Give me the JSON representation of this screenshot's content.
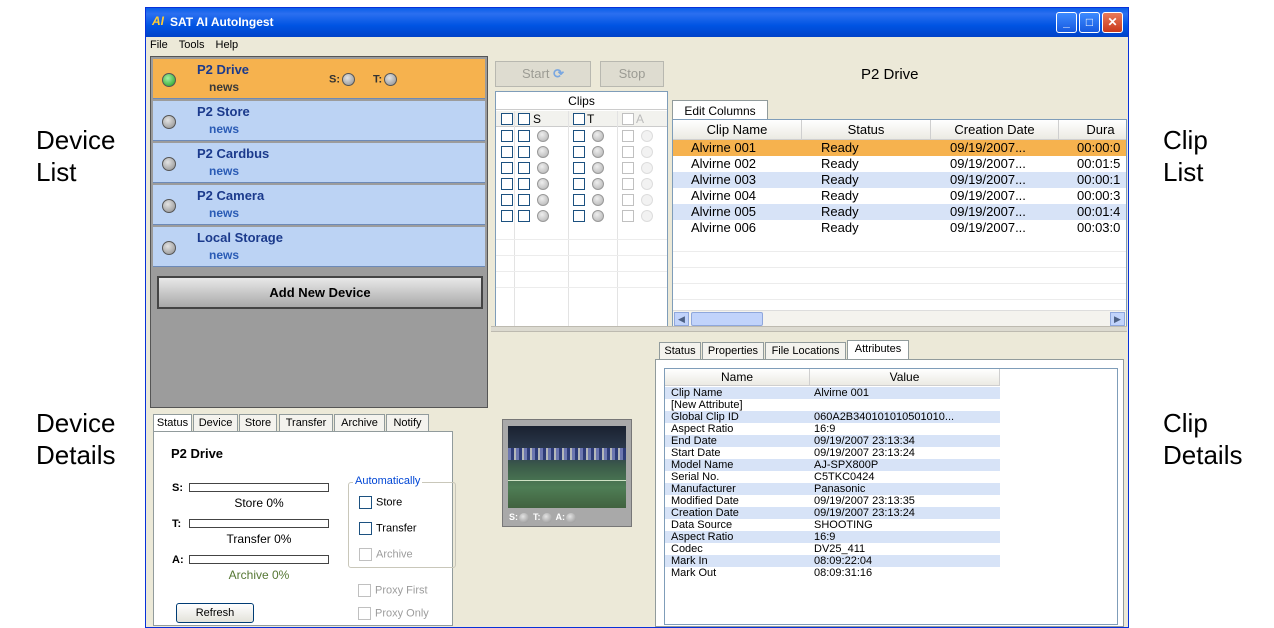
{
  "annotations": {
    "device_list": [
      "Device",
      "List"
    ],
    "device_details": [
      "Device",
      "Details"
    ],
    "clip_list": [
      "Clip",
      "List"
    ],
    "clip_details": [
      "Clip",
      "Details"
    ]
  },
  "window": {
    "icon_text": "AI",
    "title": "SAT AI AutoIngest",
    "controls": {
      "minimize": "_",
      "maximize": "□",
      "close": "✕"
    }
  },
  "menu": [
    "File",
    "Tools",
    "Help"
  ],
  "devices": [
    {
      "name": "P2 Drive",
      "sub": "news",
      "selected": true,
      "s_label": "S:",
      "t_label": "T:"
    },
    {
      "name": "P2 Store",
      "sub": "news",
      "selected": false
    },
    {
      "name": "P2 Cardbus",
      "sub": "news",
      "selected": false
    },
    {
      "name": "P2 Camera",
      "sub": "news",
      "selected": false
    },
    {
      "name": "Local Storage",
      "sub": "news",
      "selected": false
    }
  ],
  "add_device_label": "Add New Device",
  "device_tabs": [
    "Status",
    "Device",
    "Store",
    "Transfer",
    "Archive",
    "Notify"
  ],
  "device_details": {
    "title": "P2 Drive",
    "s_label": "S:",
    "t_label": "T:",
    "a_label": "A:",
    "store_text": "Store 0%",
    "transfer_text": "Transfer 0%",
    "archive_text": "Archive 0%",
    "store_progress": 0,
    "transfer_progress": 0,
    "archive_progress": 0,
    "auto_legend": "Automatically",
    "cb_store": "Store",
    "cb_transfer": "Transfer",
    "cb_archive": "Archive",
    "cb_proxy_first": "Proxy First",
    "cb_proxy_only": "Proxy Only",
    "refresh_label": "Refresh"
  },
  "toolbar": {
    "start_label": "Start",
    "stop_label": "Stop",
    "drive_title": "P2 Drive"
  },
  "clips_box": {
    "header": "Clips",
    "col_s": "S",
    "col_t": "T",
    "col_a": "A"
  },
  "edit_columns_label": "Edit Columns",
  "clip_columns": [
    "Clip Name",
    "Status",
    "Creation Date",
    "Dura"
  ],
  "clips": [
    {
      "name": "Alvirne 001",
      "status": "Ready",
      "date": "09/19/2007...",
      "dur": "00:00:0"
    },
    {
      "name": "Alvirne 002",
      "status": "Ready",
      "date": "09/19/2007...",
      "dur": "00:01:5"
    },
    {
      "name": "Alvirne 003",
      "status": "Ready",
      "date": "09/19/2007...",
      "dur": "00:00:1"
    },
    {
      "name": "Alvirne 004",
      "status": "Ready",
      "date": "09/19/2007...",
      "dur": "00:00:3"
    },
    {
      "name": "Alvirne 005",
      "status": "Ready",
      "date": "09/19/2007...",
      "dur": "00:01:4"
    },
    {
      "name": "Alvirne 006",
      "status": "Ready",
      "date": "09/19/2007...",
      "dur": "00:03:0"
    }
  ],
  "video_status": {
    "s": "S:",
    "t": "T:",
    "a": "A:"
  },
  "detail_tabs": [
    "Status",
    "Properties",
    "File Locations",
    "Attributes"
  ],
  "attr_columns": [
    "Name",
    "Value"
  ],
  "attributes": [
    {
      "name": "Clip Name",
      "value": "Alvirne 001"
    },
    {
      "name": "[New Attribute]",
      "value": ""
    },
    {
      "name": "Global Clip ID",
      "value": "060A2B340101010501010..."
    },
    {
      "name": "Aspect Ratio",
      "value": "16:9"
    },
    {
      "name": "End Date",
      "value": "09/19/2007 23:13:34"
    },
    {
      "name": "Start Date",
      "value": "09/19/2007 23:13:24"
    },
    {
      "name": "Model Name",
      "value": "AJ-SPX800P"
    },
    {
      "name": "Serial No.",
      "value": "C5TKC0424"
    },
    {
      "name": "Manufacturer",
      "value": "Panasonic"
    },
    {
      "name": "Modified Date",
      "value": "09/19/2007 23:13:35"
    },
    {
      "name": "Creation Date",
      "value": "09/19/2007 23:13:24"
    },
    {
      "name": "Data Source",
      "value": "SHOOTING"
    },
    {
      "name": "Aspect Ratio",
      "value": "16:9"
    },
    {
      "name": "Codec",
      "value": "DV25_411"
    },
    {
      "name": "Mark In",
      "value": "08:09:22:04"
    },
    {
      "name": "Mark Out",
      "value": "08:09:31:16"
    }
  ]
}
